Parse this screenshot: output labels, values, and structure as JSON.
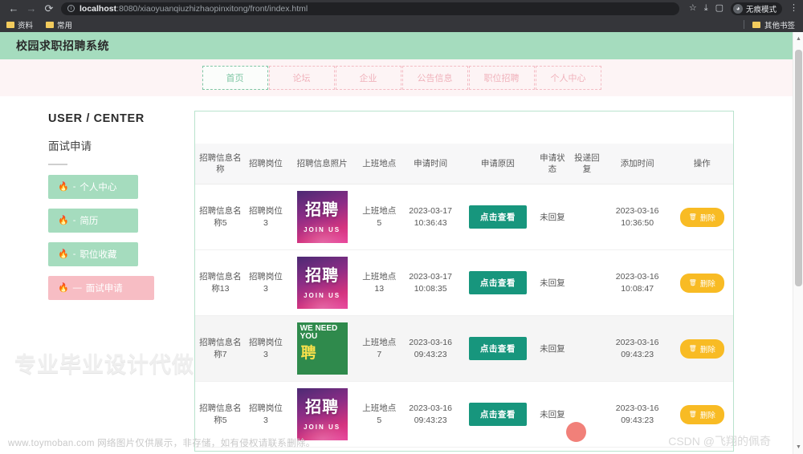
{
  "browser": {
    "back_icon": "←",
    "forward_icon": "→",
    "reload_icon": "⟳",
    "url_host": "localhost",
    "url_rest": ":8080/xiaoyuanqiuzhizhaopinxitong/front/index.html",
    "star_icon": "☆",
    "download_icon": "⤓",
    "sidepanel_icon": "▢",
    "incognito_label": "无痕模式",
    "incognito_glyph": "👓",
    "menu_icon": "⋮",
    "bookmarks": [
      {
        "label": "资料"
      },
      {
        "label": "常用"
      }
    ],
    "other_bookmarks_label": "其他书签"
  },
  "site": {
    "title": "校园求职招聘系统",
    "nav": [
      {
        "label": "首页",
        "active": true
      },
      {
        "label": "论坛",
        "active": false
      },
      {
        "label": "企业",
        "active": false
      },
      {
        "label": "公告信息",
        "active": false
      },
      {
        "label": "职位招聘",
        "active": false
      },
      {
        "label": "个人中心",
        "active": false
      }
    ]
  },
  "sidebar": {
    "heading": "USER / CENTER",
    "subheading": "面试申请",
    "items": [
      {
        "label": "个人中心",
        "icon": "🔥",
        "sep": "-",
        "active": false
      },
      {
        "label": "简历",
        "icon": "🔥",
        "sep": "-",
        "active": false
      },
      {
        "label": "职位收藏",
        "icon": "🔥",
        "sep": "-",
        "active": false
      },
      {
        "label": "面试申请",
        "icon": "🔥",
        "sep": "—",
        "active": true
      }
    ]
  },
  "table": {
    "headers": [
      "招聘信息名称",
      "招聘岗位",
      "招聘信息照片",
      "上班地点",
      "申请时间",
      "申请原因",
      "申请状态",
      "投递回复",
      "添加时间",
      "操作"
    ],
    "view_button_label": "点击查看",
    "delete_button_label": "删除",
    "delete_icon": "🗑",
    "rows": [
      {
        "name": "招聘信息名称5",
        "position": "招聘岗位3",
        "photo": {
          "style": "purple",
          "big": "招聘",
          "small": "JOIN US"
        },
        "location": "上班地点5",
        "apply_time": "2023-03-17 10:36:43",
        "reason": "点击查看",
        "status": "未回复",
        "reply": "",
        "add_time": "2023-03-16 10:36:50",
        "action": "删除",
        "hover": false
      },
      {
        "name": "招聘信息名称13",
        "position": "招聘岗位3",
        "photo": {
          "style": "purple",
          "big": "招聘",
          "small": "JOIN US"
        },
        "location": "上班地点13",
        "apply_time": "2023-03-17 10:08:35",
        "reason": "点击查看",
        "status": "未回复",
        "reply": "",
        "add_time": "2023-03-16 10:08:47",
        "action": "删除",
        "hover": false
      },
      {
        "name": "招聘信息名称7",
        "position": "招聘岗位3",
        "photo": {
          "style": "green",
          "big": "聘",
          "small": "WE NEED YOU"
        },
        "location": "上班地点7",
        "apply_time": "2023-03-16 09:43:23",
        "reason": "点击查看",
        "status": "未回复",
        "reply": "",
        "add_time": "2023-03-16 09:43:23",
        "action": "删除",
        "hover": true
      },
      {
        "name": "招聘信息名称5",
        "position": "招聘岗位3",
        "photo": {
          "style": "purple",
          "big": "招聘",
          "small": "JOIN US"
        },
        "location": "上班地点5",
        "apply_time": "2023-03-16 09:43:23",
        "reason": "点击查看",
        "status": "未回复",
        "reply": "",
        "add_time": "2023-03-16 09:43:23",
        "action": "删除",
        "hover": false
      }
    ]
  },
  "watermarks": {
    "main": "专业毕业设计代做",
    "footer": "www.toymoban.com 网络图片仅供展示，非存储，如有侵权请联系删除。",
    "csdn": "CSDN @飞翔的佩奇"
  },
  "colors": {
    "header_green": "#a5dcbe",
    "accent_pink": "#f7bdc4",
    "view_button": "#17967d",
    "delete_button": "#f8bb24"
  }
}
